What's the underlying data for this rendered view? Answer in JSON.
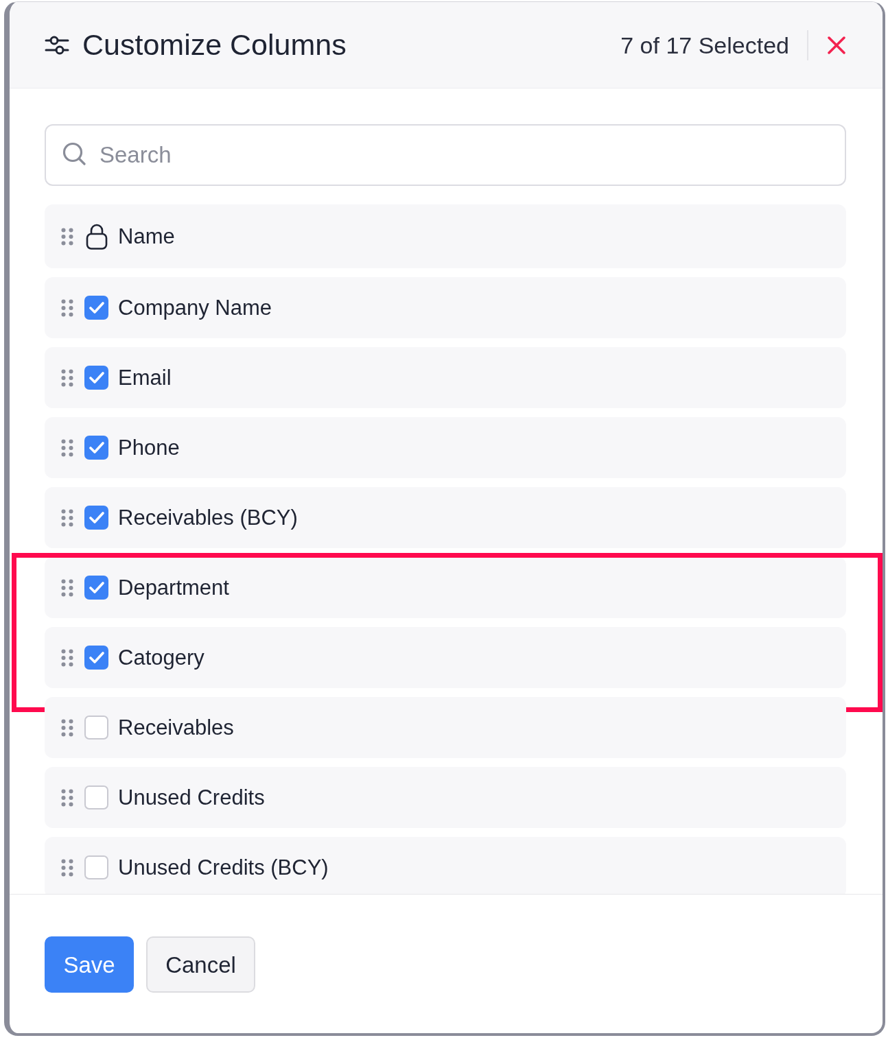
{
  "dialog": {
    "title": "Customize Columns",
    "selection_count": "7 of 17 Selected"
  },
  "search": {
    "placeholder": "Search"
  },
  "columns": [
    {
      "kind": "locked",
      "label": "Name",
      "highlighted": false
    },
    {
      "kind": "checkbox",
      "label": "Company Name",
      "checked": true,
      "highlighted": false
    },
    {
      "kind": "checkbox",
      "label": "Email",
      "checked": true,
      "highlighted": false
    },
    {
      "kind": "checkbox",
      "label": "Phone",
      "checked": true,
      "highlighted": false
    },
    {
      "kind": "checkbox",
      "label": "Receivables (BCY)",
      "checked": true,
      "highlighted": false
    },
    {
      "kind": "checkbox",
      "label": "Department",
      "checked": true,
      "highlighted": true
    },
    {
      "kind": "checkbox",
      "label": "Catogery",
      "checked": true,
      "highlighted": true
    },
    {
      "kind": "checkbox",
      "label": "Receivables",
      "checked": false,
      "highlighted": false
    },
    {
      "kind": "checkbox",
      "label": "Unused Credits",
      "checked": false,
      "highlighted": false
    },
    {
      "kind": "checkbox",
      "label": "Unused Credits (BCY)",
      "checked": false,
      "highlighted": false
    }
  ],
  "footer": {
    "buttons": [
      {
        "label": "Save",
        "kind": "primary"
      },
      {
        "label": "Cancel",
        "kind": "secondary"
      }
    ]
  }
}
